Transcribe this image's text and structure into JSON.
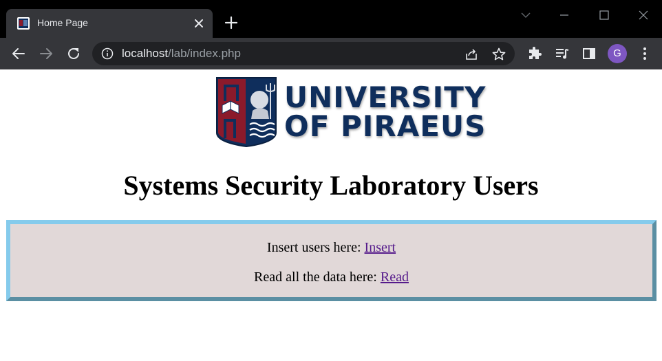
{
  "browser": {
    "tab_title": "Home Page",
    "url_host": "localhost",
    "url_path": "/lab/index.php",
    "profile_initial": "G"
  },
  "logo": {
    "line1": "UNIVERSITY",
    "line2": "OF PIRAEUS",
    "colors": {
      "navy": "#0f2e5c",
      "crimson": "#8b1a2b"
    }
  },
  "page": {
    "heading": "Systems Security Laboratory Users",
    "insert_text": "Insert users here: ",
    "insert_link": "Insert",
    "read_text": "Read all the data here: ",
    "read_link": "Read"
  },
  "colors": {
    "box_background": "#e1d8d8",
    "box_border_light": "#85cbec",
    "box_border_dark": "#5b8fa3",
    "link_visited": "#551a8b"
  }
}
